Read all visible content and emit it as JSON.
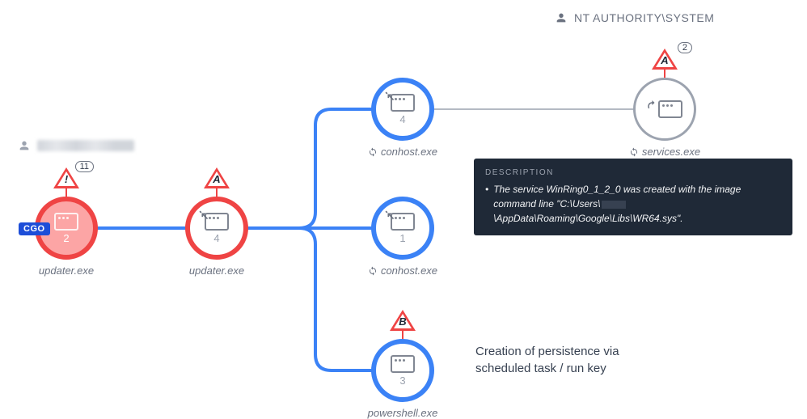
{
  "users": {
    "right": "NT AUTHORITY\\SYSTEM"
  },
  "nodes": {
    "updater1": {
      "label": "updater.exe",
      "count": "2",
      "tag": "CGO",
      "alert": {
        "letter": "!",
        "count": "11"
      }
    },
    "updater2": {
      "label": "updater.exe",
      "count": "4",
      "alert": {
        "letter": "A"
      }
    },
    "conhost1": {
      "label": "conhost.exe",
      "count": "4"
    },
    "conhost2": {
      "label": "conhost.exe",
      "count": "1"
    },
    "powershell": {
      "label": "powershell.exe",
      "count": "3",
      "alert": {
        "letter": "B"
      }
    },
    "services": {
      "label": "services.exe",
      "alert": {
        "letter": "A",
        "count": "2"
      }
    }
  },
  "description": {
    "title": "DESCRIPTION",
    "body_prefix": "The service WinRing0_1_2_0 was created with the image command line \"C:\\Users\\",
    "body_suffix": "\\AppData\\Roaming\\Google\\Libs\\WR64.sys\"."
  },
  "annotation": {
    "line1": "Creation of persistence via",
    "line2": "scheduled task / run key"
  }
}
